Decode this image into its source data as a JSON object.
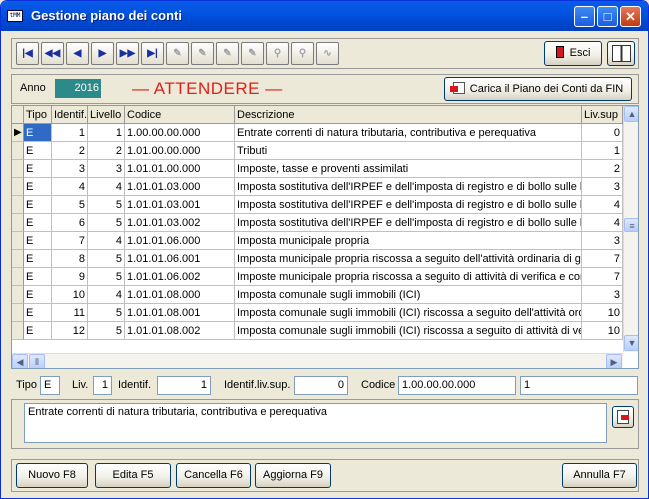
{
  "window": {
    "title": "Gestione piano dei conti",
    "app_icon_text": "tMM"
  },
  "toolbar": {
    "nav_buttons": [
      {
        "name": "first-record-button",
        "glyph": "|◀",
        "enabled": true
      },
      {
        "name": "prev-page-button",
        "glyph": "◀◀",
        "enabled": true
      },
      {
        "name": "prev-record-button",
        "glyph": "◀",
        "enabled": true
      },
      {
        "name": "next-record-button",
        "glyph": "▶",
        "enabled": true
      },
      {
        "name": "next-page-button",
        "glyph": "▶▶",
        "enabled": true
      },
      {
        "name": "last-record-button",
        "glyph": "▶|",
        "enabled": true
      },
      {
        "name": "insert-record-button",
        "glyph": "✎",
        "enabled": false
      },
      {
        "name": "delete-record-button",
        "glyph": "✎",
        "enabled": false
      },
      {
        "name": "edit-record-button",
        "glyph": "✎",
        "enabled": false
      },
      {
        "name": "post-record-button",
        "glyph": "✎",
        "enabled": false
      },
      {
        "name": "find-button",
        "glyph": "⚲",
        "enabled": false
      },
      {
        "name": "find-next-button",
        "glyph": "⚲",
        "enabled": false
      },
      {
        "name": "refresh-button",
        "glyph": "∿",
        "enabled": false
      }
    ],
    "exit_label": "Esci"
  },
  "anno": {
    "label": "Anno",
    "value": "2016",
    "status": "— ATTENDERE —",
    "load_button": "Carica il Piano dei Conti da FIN"
  },
  "grid": {
    "columns": [
      "Tipo",
      "Identif.",
      "Livello",
      "Codice",
      "Descrizione",
      "Liv.sup"
    ],
    "rows": [
      {
        "tipo": "E",
        "identif": "1",
        "livello": "1",
        "codice": "1.00.00.00.000",
        "descrizione": "Entrate correnti di natura tributaria, contributiva e perequativa",
        "livsup": "0"
      },
      {
        "tipo": "E",
        "identif": "2",
        "livello": "2",
        "codice": "1.01.00.00.000",
        "descrizione": "Tributi",
        "livsup": "1"
      },
      {
        "tipo": "E",
        "identif": "3",
        "livello": "3",
        "codice": "1.01.01.00.000",
        "descrizione": "Imposte, tasse e proventi assimilati",
        "livsup": "2"
      },
      {
        "tipo": "E",
        "identif": "4",
        "livello": "4",
        "codice": "1.01.01.03.000",
        "descrizione": "Imposta sostitutiva dell'IRPEF e dell'imposta di registro e di bollo sulle locazioni",
        "livsup": "3"
      },
      {
        "tipo": "E",
        "identif": "5",
        "livello": "5",
        "codice": "1.01.01.03.001",
        "descrizione": "Imposta sostitutiva dell'IRPEF e dell'imposta di registro e di bollo sulle locazioni",
        "livsup": "4"
      },
      {
        "tipo": "E",
        "identif": "6",
        "livello": "5",
        "codice": "1.01.01.03.002",
        "descrizione": "Imposta sostitutiva dell'IRPEF e dell'imposta di registro e di bollo sulle locazioni",
        "livsup": "4"
      },
      {
        "tipo": "E",
        "identif": "7",
        "livello": "4",
        "codice": "1.01.01.06.000",
        "descrizione": "Imposta municipale propria",
        "livsup": "3"
      },
      {
        "tipo": "E",
        "identif": "8",
        "livello": "5",
        "codice": "1.01.01.06.001",
        "descrizione": "Imposta municipale propria riscossa a seguito dell'attività ordinaria di gestione",
        "livsup": "7"
      },
      {
        "tipo": "E",
        "identif": "9",
        "livello": "5",
        "codice": "1.01.01.06.002",
        "descrizione": "Imposte municipale propria riscossa a seguito di attività di verifica e controllo",
        "livsup": "7"
      },
      {
        "tipo": "E",
        "identif": "10",
        "livello": "4",
        "codice": "1.01.01.08.000",
        "descrizione": "Imposta comunale sugli immobili (ICI)",
        "livsup": "3"
      },
      {
        "tipo": "E",
        "identif": "11",
        "livello": "5",
        "codice": "1.01.01.08.001",
        "descrizione": "Imposta comunale sugli immobili (ICI) riscossa a seguito dell'attività ordinaria",
        "livsup": "10"
      },
      {
        "tipo": "E",
        "identif": "12",
        "livello": "5",
        "codice": "1.01.01.08.002",
        "descrizione": "Imposta comunale sugli immobili (ICI) riscossa a seguito di attività di verifica",
        "livsup": "10"
      }
    ]
  },
  "detail": {
    "tipo_label": "Tipo",
    "tipo_value": "E",
    "liv_label": "Liv.",
    "liv_value": "1",
    "identif_label": "Identif.",
    "identif_value": "1",
    "identif_sup_label": "Identif.liv.sup.",
    "identif_sup_value": "0",
    "codice_label": "Codice",
    "codice_value": "1.00.00.00.000",
    "extra_value": "1",
    "descrizione_value": "Entrate correnti di natura tributaria, contributiva e perequativa"
  },
  "buttons": {
    "nuovo": "Nuovo F8",
    "edita": "Edita F5",
    "cancella": "Cancella F6",
    "aggiorna": "Aggiorna F9",
    "annulla": "Annulla F7"
  },
  "colors": {
    "anno_bg": "#2c8a8a",
    "status_red": "#e0201a",
    "selection_blue": "#316ac5"
  }
}
